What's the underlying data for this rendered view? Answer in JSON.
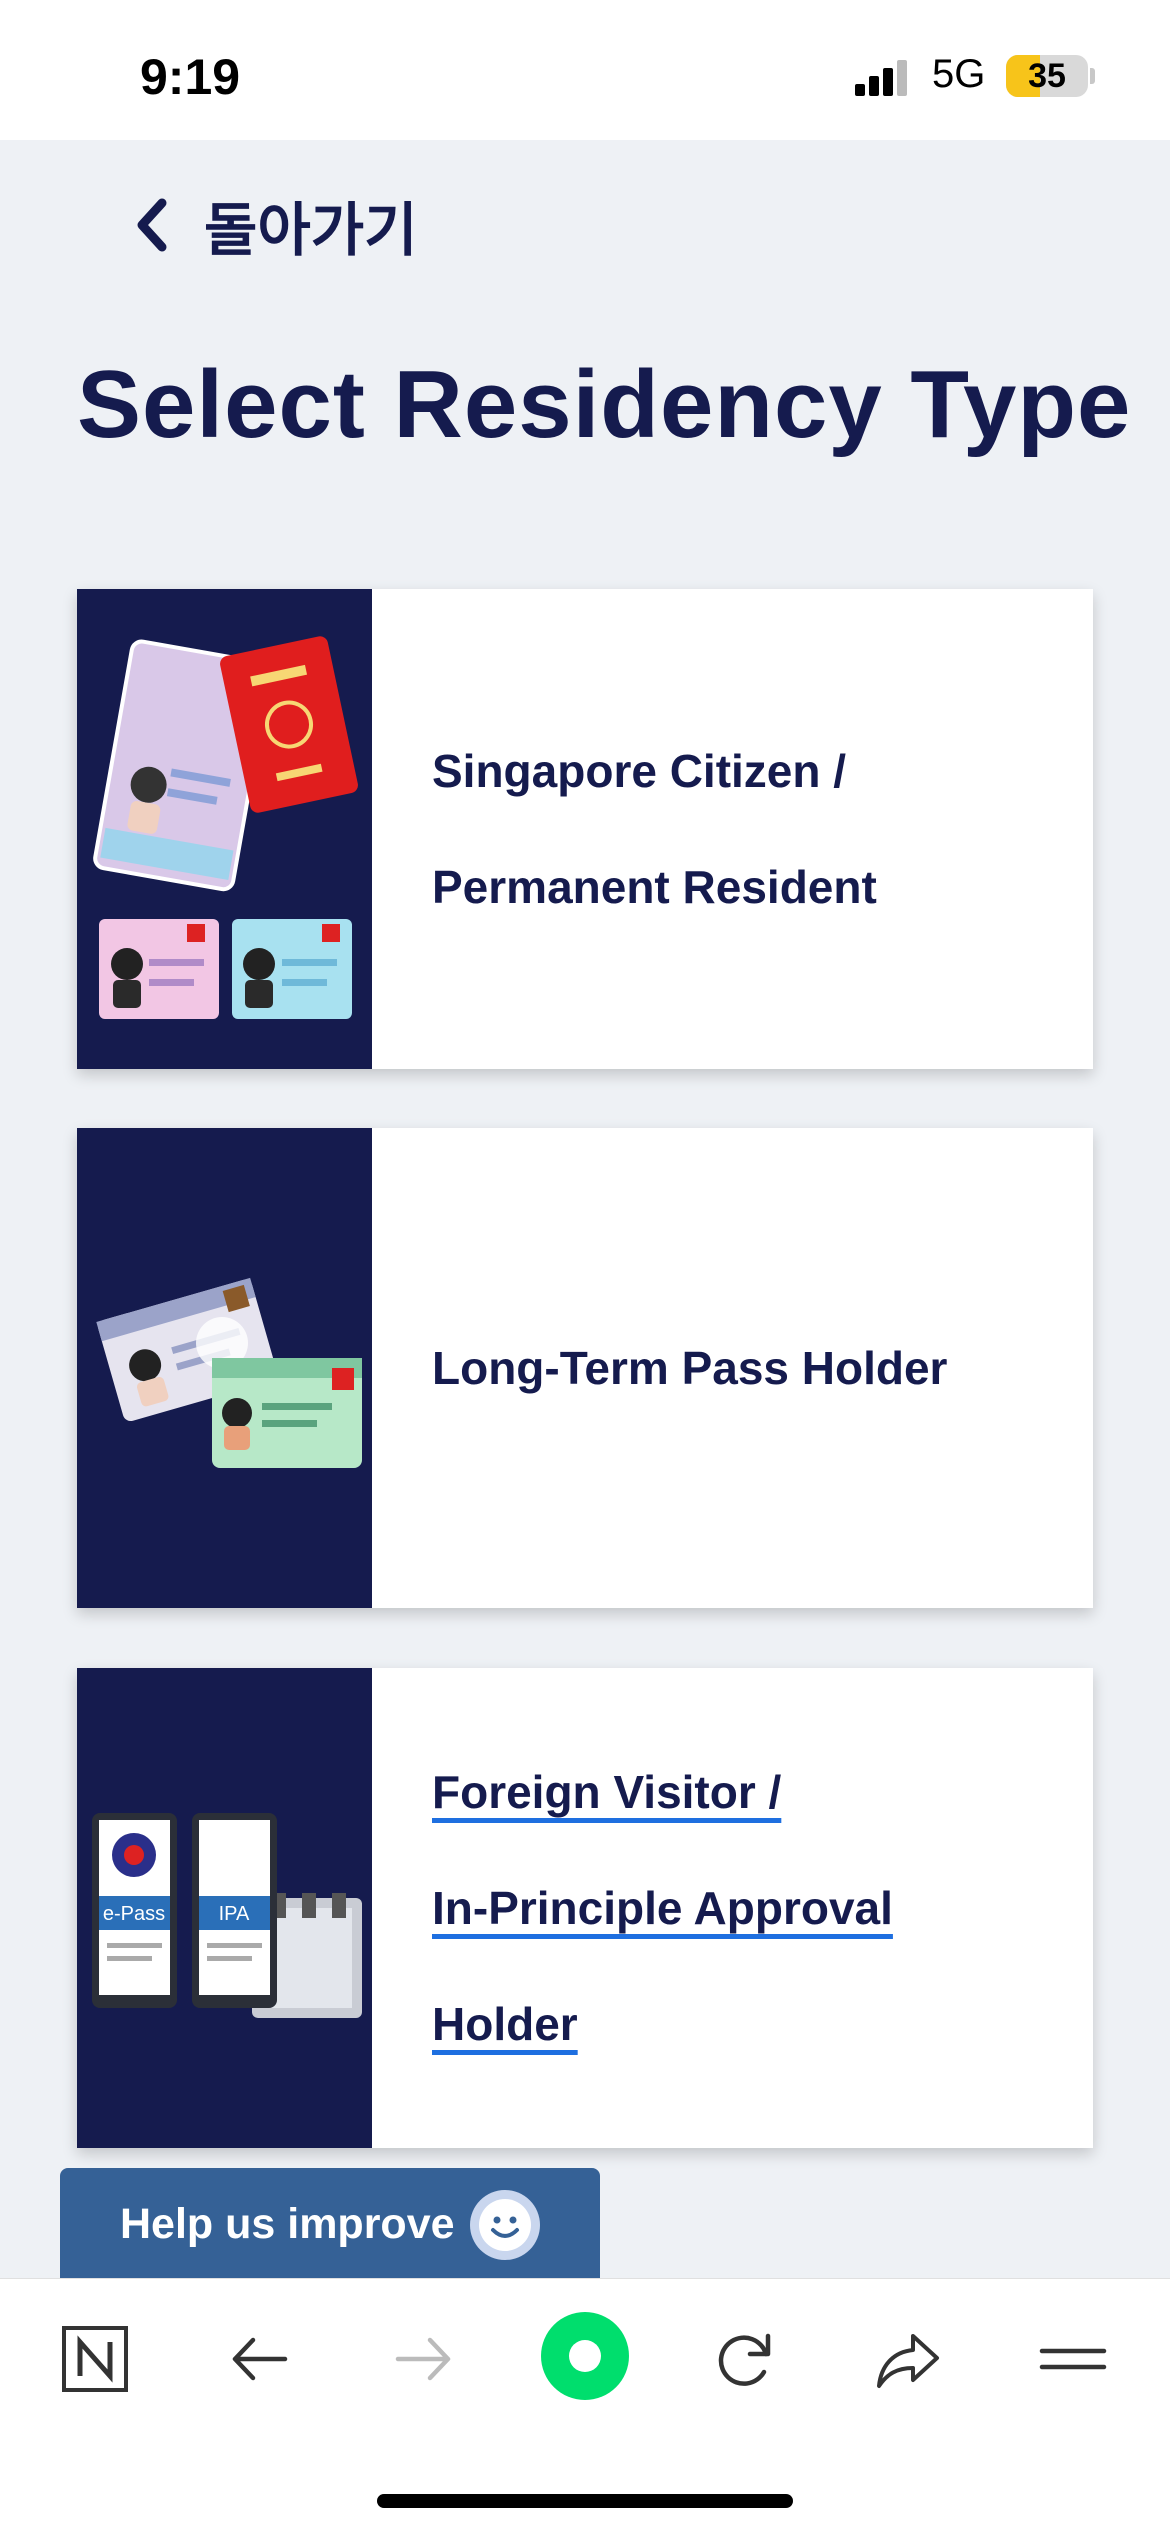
{
  "status_bar": {
    "time": "9:19",
    "network": "5G",
    "battery": "35"
  },
  "nav": {
    "back_label": "돌아가기"
  },
  "page": {
    "title": "Select Residency Type"
  },
  "cards": [
    {
      "lines": [
        "Singapore Citizen /",
        "Permanent Resident"
      ]
    },
    {
      "lines": [
        "Long-Term Pass Holder"
      ]
    },
    {
      "lines": [
        "Foreign Visitor /",
        "In-Principle Approval",
        "Holder"
      ],
      "image_labels": [
        "e-Pass",
        "IPA"
      ]
    }
  ],
  "feedback": {
    "label": "Help us improve"
  },
  "toolbar": {
    "items": [
      "naver-icon",
      "back-arrow-icon",
      "forward-arrow-icon",
      "home-circle-icon",
      "reload-icon",
      "share-icon",
      "menu-icon"
    ]
  },
  "colors": {
    "navy": "#151b4e",
    "background": "#eef1f5",
    "link_underline": "#1e6fe0",
    "help_button": "#356196",
    "home_green": "#00de6d"
  }
}
